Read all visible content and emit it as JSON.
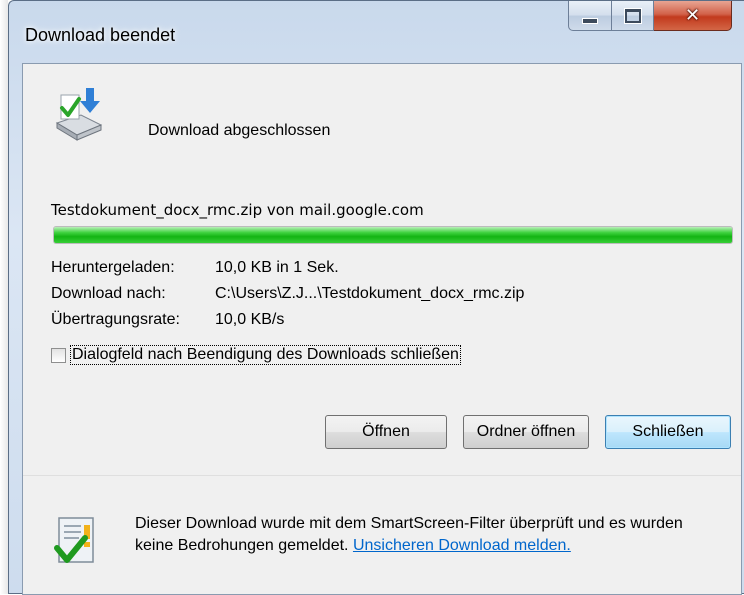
{
  "window": {
    "title": "Download beendet"
  },
  "header": {
    "status_text": "Download abgeschlossen"
  },
  "download": {
    "filename_line": "Testdokument_docx_rmc.zip von mail.google.com",
    "progress_fraction": 1.0,
    "rows": [
      {
        "label": "Heruntergeladen:",
        "value": "10,0 KB in 1 Sek."
      },
      {
        "label": "Download nach:",
        "value": "C:\\Users\\Z.J...\\Testdokument_docx_rmc.zip"
      },
      {
        "label": "Übertragungsrate:",
        "value": "10,0 KB/s"
      }
    ]
  },
  "options": {
    "close_on_finish_label": "Dialogfeld nach Beendigung des Downloads schließen",
    "close_on_finish_checked": false
  },
  "buttons": {
    "open_label": "Öffnen",
    "open_folder_label": "Ordner öffnen",
    "close_label": "Schließen"
  },
  "footer": {
    "message": "Dieser Download wurde mit dem SmartScreen-Filter überprüft und es wurden keine Bedrohungen gemeldet.",
    "link_text": "Unsicheren Download melden."
  },
  "colors": {
    "progress_green": "#14b414",
    "link_blue": "#0066cc",
    "close_button_red": "#c23a1d"
  },
  "icons": {
    "header": "download-complete-icon",
    "footer": "smartscreen-check-icon",
    "minimize": "minimize-icon",
    "maximize": "maximize-icon",
    "close": "close-icon"
  }
}
